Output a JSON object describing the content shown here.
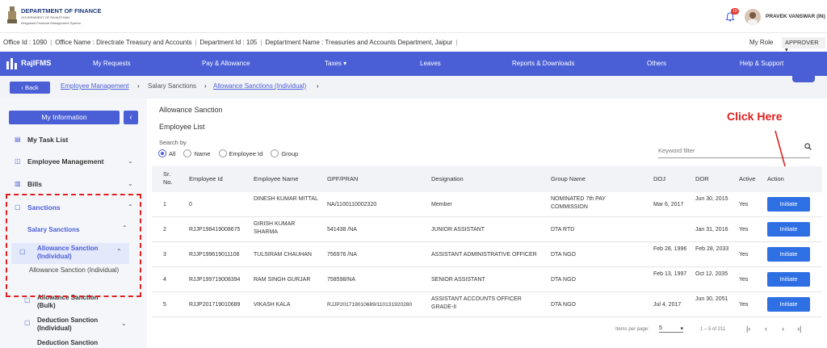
{
  "header": {
    "dept_title": "DEPARTMENT OF FINANCE",
    "dept_sub1": "GOVERNMENT OF RAJASTHAN",
    "dept_sub2": "Integrated Financial Management System",
    "notification_count": "10",
    "user_name": "PRAVEK VANSWAR (IN)"
  },
  "office_bar": {
    "office_id": "Office Id : 1090",
    "office_name": "Office Name : Directrate Treasury and Accounts",
    "department_id": "Department Id : 105",
    "department_name": "Deptartment Name : Treasuries and Accounts Department, Jaipur",
    "role_label": "My Role",
    "role_value": "APPROVER"
  },
  "nav": {
    "brand": "RajIFMS",
    "items": [
      "My Requests",
      "Pay & Allowance",
      "Taxes ▾",
      "Leaves",
      "Reports & Downloads",
      "Others",
      "Help & Support"
    ]
  },
  "breadcrumb": {
    "back_label": "Back",
    "items": [
      "Employee Management",
      "Salary Sanctions",
      "Allowance Sanctions (Individual)"
    ]
  },
  "sidebar": {
    "my_info": "My Information",
    "toggle": "‹",
    "items": [
      "My Task List",
      "Employee Management",
      "Bills",
      "Sanctions"
    ],
    "sub_salary": "Salary Sanctions",
    "sub_allowance": "Allowance Sanction (Individual)",
    "sub_allowance_tooltip": "Allowance Sanction (Individual)",
    "sub_allowance_bulk": "Allowance Sanction (Bulk)",
    "sub_deduction": "Deduction Sanction (Individual)",
    "sub_cut": "Deduction Sanction"
  },
  "main": {
    "title": "Allowance Sanction",
    "subtitle": "Employee List",
    "search_by": "Search by",
    "radios": [
      "All",
      "Name",
      "Employee Id",
      "Group"
    ],
    "keyword_placeholder": "Keyword filter",
    "annotation": "Click Here",
    "columns": [
      "Sr. No.",
      "Employee Id",
      "Employee Name",
      "GPF/PRAN",
      "Designation",
      "Group Name",
      "DOJ",
      "DOR",
      "Active",
      "Action"
    ],
    "rows": [
      {
        "sr": "1",
        "emp_id": "0",
        "name": "DINESH KUMAR MITTAL",
        "gpf": "NA/1100110002320",
        "designation": "Member",
        "group": "NOMINATED 7th PAY COMMISSION",
        "doj": "Mar 6, 2017",
        "dor": "Jun 30, 2015",
        "active": "Yes",
        "action": "Initiate"
      },
      {
        "sr": "2",
        "emp_id": "RJJP198419008675",
        "name": "GIRISH KUMAR SHARMA",
        "gpf": "541438 /NA",
        "designation": "JUNIOR ASSISTANT",
        "group": "DTA RTD",
        "doj": "",
        "dor": "Jan 31, 2016",
        "active": "Yes",
        "action": "Initiate"
      },
      {
        "sr": "3",
        "emp_id": "RJJP199619011108",
        "name": "TULSIRAM CHAUHAN",
        "gpf": "756976 /NA",
        "designation": "ASSISTANT ADMINISTRATIVE OFFICER",
        "group": "DTA NGO",
        "doj": "Feb 28, 1996",
        "dor": "Feb 28, 2033",
        "active": "Yes",
        "action": "Initiate"
      },
      {
        "sr": "4",
        "emp_id": "RJJP199719008394",
        "name": "RAM SINGH GURJAR",
        "gpf": "758598/NA",
        "designation": "SENIOR ASSISTANT",
        "group": "DTA NGO",
        "doj": "Feb 13, 1997",
        "dor": "Oct 12, 2035",
        "active": "Yes",
        "action": "Initiate"
      },
      {
        "sr": "5",
        "emp_id": "RJJP201719010689",
        "name": "VIKASH KALA",
        "gpf": "RJJP201719010689/110131920280",
        "designation": "ASSISTANT ACCOUNTS OFFICER GRADE-II",
        "group": "DTA NGO",
        "doj": "Jul 4, 2017",
        "dor": "Jun 30, 2051",
        "active": "Yes",
        "action": "Initiate"
      }
    ],
    "items_per_page_label": "Items per page:",
    "items_per_page_value": "5",
    "range_label": "1 – 5 of 211"
  }
}
